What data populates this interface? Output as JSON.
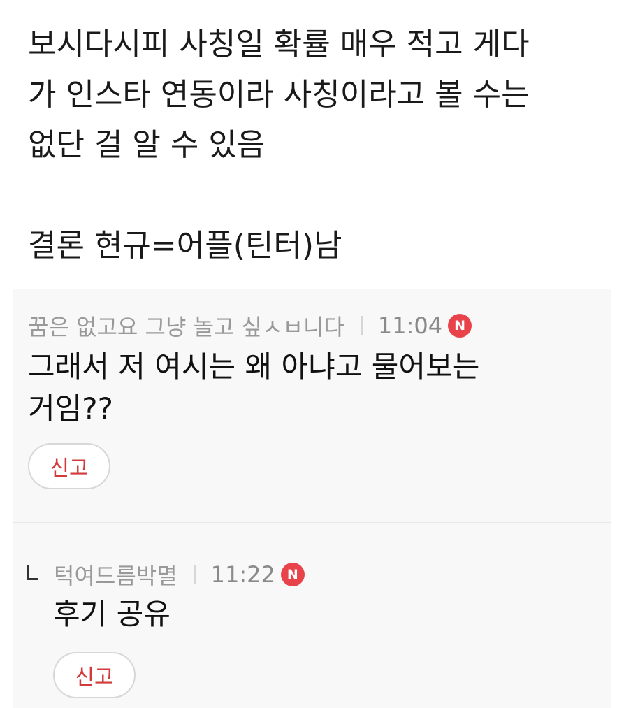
{
  "post": {
    "lines": [
      "보시다시피 사칭일 확률 매우 적고 게다",
      "가 인스타 연동이라 사칭이라고 볼 수는",
      "없단 걸 알 수 있음",
      "결론 현규=어플(틴터)남"
    ]
  },
  "comments": [
    {
      "author": "꿈은 없고요 그냥 놀고 싶ㅅㅂ니다",
      "time": "11:04",
      "badge": "N",
      "text_lines": [
        "그래서 저 여시는 왜 아냐고 물어보는",
        "거임??"
      ],
      "report_label": "신고"
    },
    {
      "author": "턱여드름박멸",
      "time": "11:22",
      "badge": "N",
      "text_lines": [
        "후기 공유"
      ],
      "report_label": "신고",
      "is_reply": true
    }
  ],
  "colors": {
    "badge": "#e8434a",
    "report_text": "#d23b3b",
    "comment_bg": "#f8f8f8",
    "meta_text": "#999999"
  }
}
